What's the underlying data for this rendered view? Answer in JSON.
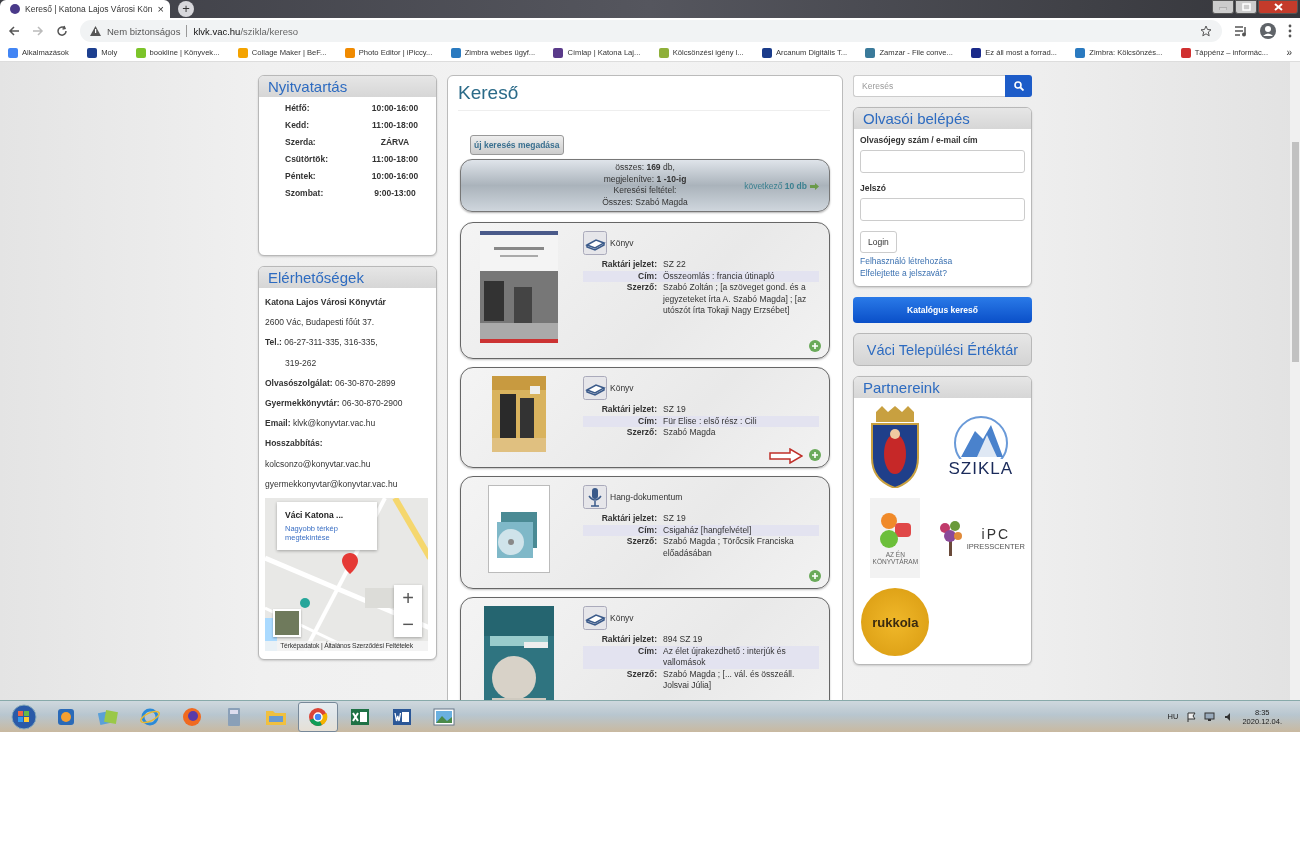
{
  "browser": {
    "tab": {
      "title": "Kereső | Katona Lajos Városi Kön",
      "close": "×"
    },
    "new_tab": "+",
    "address": {
      "security": "Nem biztonságos",
      "host": "klvk.vac.hu",
      "path": "/szikla/kereso"
    },
    "bookmarks": [
      {
        "label": "Alkalmazások",
        "color": "#4285f4"
      },
      {
        "label": "Moly",
        "color": "#1d3f8f"
      },
      {
        "label": "bookline | Könyvek...",
        "color": "#7cc42a"
      },
      {
        "label": "Collage Maker | BeF...",
        "color": "#f4a300"
      },
      {
        "label": "Photo Editor | iPiccy...",
        "color": "#f08a00"
      },
      {
        "label": "Zimbra webes ügyf...",
        "color": "#2a7ac0"
      },
      {
        "label": "Címlap | Katona Laj...",
        "color": "#5a3a8a"
      },
      {
        "label": "Kölcsönzési igény l...",
        "color": "#8fb03a"
      },
      {
        "label": "Arcanum Digitális T...",
        "color": "#1a3b8a"
      },
      {
        "label": "Zamzar - File conve...",
        "color": "#3a7a9a"
      },
      {
        "label": "Ez áll most a forrad...",
        "color": "#1a2a8a"
      },
      {
        "label": "Zimbra: Kölcsönzés...",
        "color": "#2a7ac0"
      },
      {
        "label": "Táppénz – informác...",
        "color": "#d03030"
      }
    ],
    "bookmarks_more": "»"
  },
  "opening_hours": {
    "title": "Nyitvatartás",
    "rows": [
      {
        "day": "Hétfő:",
        "hours": "10:00-16:00"
      },
      {
        "day": "Kedd:",
        "hours": "11:00-18:00"
      },
      {
        "day": "Szerda:",
        "hours": "ZÁRVA"
      },
      {
        "day": "Csütörtök:",
        "hours": "11:00-18:00"
      },
      {
        "day": "Péntek:",
        "hours": "10:00-16:00"
      },
      {
        "day": "Szombat:",
        "hours": "9:00-13:00"
      }
    ]
  },
  "contacts": {
    "title": "Elérhetőségek",
    "lines": [
      {
        "kind": "heading",
        "text": "Katona Lajos Városi Könyvtár"
      },
      {
        "kind": "plain",
        "text": "2600 Vác, Budapesti főút 37."
      },
      {
        "kind": "plain",
        "text": "**Tel.:** 06-27-311-335, 316-335,"
      },
      {
        "kind": "continued",
        "text": "319-262"
      },
      {
        "kind": "plain",
        "text": "**Olvasószolgálat:** 06-30-870-2899"
      },
      {
        "kind": "plain",
        "text": "**Gyermekkönyvtár:** 06-30-870-2900"
      },
      {
        "kind": "plain",
        "text": "**Email:** klvk@konyvtar.vac.hu"
      },
      {
        "kind": "heading",
        "text": "Hosszabbítás:"
      },
      {
        "kind": "plain",
        "text": "kolcsonzo@konyvtar.vac.hu"
      },
      {
        "kind": "plain",
        "text": "gyermekkonyvtar@konyvtar.vac.hu"
      }
    ],
    "map": {
      "place": "Váci Katona ...",
      "link": "Nagyobb térkép megtekintése",
      "zoom_in": "+",
      "zoom_out": "−",
      "footer": "Térképadatok | Általános Szerződési Feltételek"
    }
  },
  "search": {
    "title": "Kereső",
    "new_search": "új keresés megadása",
    "summary": [
      "összes: **169** db,",
      "megjelenítve: **1 -10-ig**",
      "Keresési feltétel:",
      "Összes: Szabó Magda"
    ],
    "next": "következő **10 db**",
    "results": [
      {
        "kind": "book",
        "type": "Könyv",
        "marked": false,
        "fields": [
          {
            "label": "Raktári jelzet:",
            "value": "SZ 22"
          },
          {
            "label": "Cím:",
            "value": "Összeomlás : francia útinapló"
          },
          {
            "label": "Szerző:",
            "value": "Szabó Zoltán ; [a szöveget gond. és a jegyzeteket írta A. Szabó Magda] ; [az utószót írta Tokaji Nagy Erzsébet]"
          }
        ]
      },
      {
        "kind": "book",
        "type": "Könyv",
        "marked": true,
        "fields": [
          {
            "label": "Raktári jelzet:",
            "value": "SZ 19"
          },
          {
            "label": "Cím:",
            "value": "Für Elise : első rész : Cili"
          },
          {
            "label": "Szerző:",
            "value": "Szabó Magda"
          }
        ]
      },
      {
        "kind": "audio",
        "type": "Hang-dokumentum",
        "marked": false,
        "fields": [
          {
            "label": "Raktári jelzet:",
            "value": "SZ 19"
          },
          {
            "label": "Cím:",
            "value": "Csigaház [hangfelvétel]"
          },
          {
            "label": "Szerző:",
            "value": "Szabó Magda ; Törőcsik Franciska előadásában"
          }
        ]
      },
      {
        "kind": "book",
        "type": "Könyv",
        "marked": false,
        "fields": [
          {
            "label": "Raktári jelzet:",
            "value": "894 SZ 19"
          },
          {
            "label": "Cím:",
            "value": "Az élet újrakezdhető : interjúk és vallomások"
          },
          {
            "label": "Szerző:",
            "value": "Szabó Magda ; [... vál. és összeáll. Jolsvai Júlia]"
          }
        ]
      }
    ]
  },
  "sidebar": {
    "search_placeholder": "Keresés",
    "login": {
      "title": "Olvasói belépés",
      "user_label": "Olvasójegy szám / e-mail cím",
      "password_label": "Jelszó",
      "button": "Login",
      "links": [
        "Felhasználó létrehozása",
        "Elfelejtette a jelszavát?"
      ]
    },
    "catalog_button": "Katalógus kereső",
    "heritage": "Váci Települési Értéktár",
    "partners": {
      "title": "Partnereink",
      "logos": [
        {
          "kind": "crest"
        },
        {
          "kind": "szikla",
          "text": "SZIKLA"
        },
        {
          "kind": "konyvtaram",
          "text": "AZ ÉN KÖNYVTÁRAM"
        },
        {
          "kind": "ipc",
          "text": "iPC",
          "subtext": "IPRESSCENTER"
        },
        {
          "kind": "rukkola",
          "text": "rukkola"
        }
      ]
    }
  },
  "taskbar": {
    "apps": [
      {
        "kind": "start",
        "selected": false
      },
      {
        "kind": "media",
        "selected": false
      },
      {
        "kind": "gallery",
        "selected": false
      },
      {
        "kind": "ie",
        "selected": false
      },
      {
        "kind": "firefox",
        "selected": false
      },
      {
        "kind": "calculator",
        "selected": false
      },
      {
        "kind": "folder",
        "selected": false
      },
      {
        "kind": "chrome",
        "selected": true
      },
      {
        "kind": "excel",
        "selected": false
      },
      {
        "kind": "word",
        "selected": false
      },
      {
        "kind": "photos",
        "selected": false
      }
    ],
    "language": "HU",
    "time": "8:35",
    "date": "2020.12.04."
  }
}
